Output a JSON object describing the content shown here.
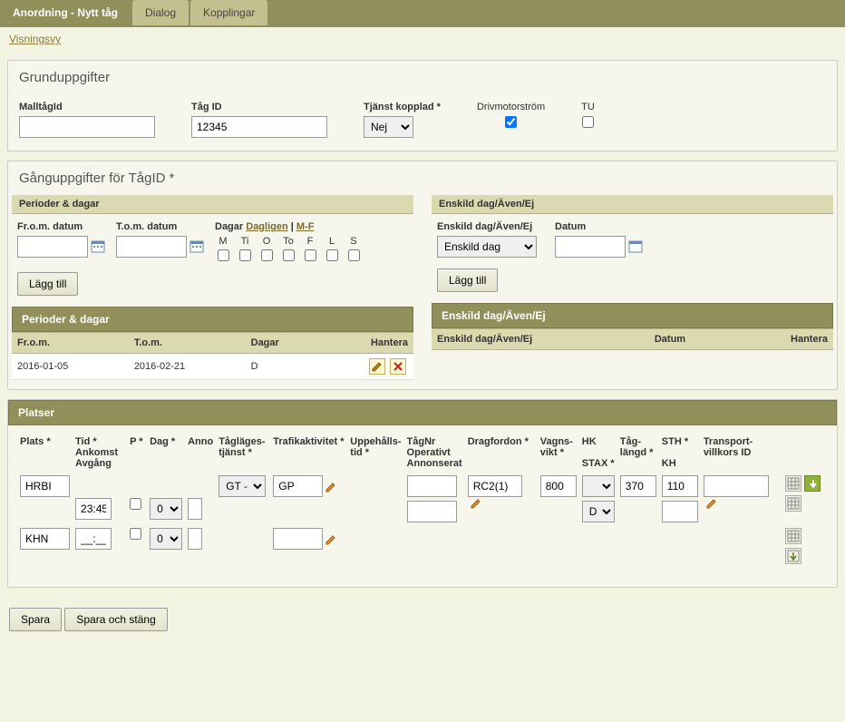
{
  "tabs": {
    "t0": "Anordning - Nytt tåg",
    "t1": "Dialog",
    "t2": "Kopplingar"
  },
  "link": {
    "visningsvy": "Visningsvy"
  },
  "grund": {
    "title": "Grunduppgifter",
    "malltagid_label": "MalltågId",
    "malltagid_value": "",
    "tagid_label": "Tåg ID",
    "tagid_value": "12345",
    "tjanst_label": "Tjänst kopplad *",
    "tjanst_value": "Nej",
    "driv_label": "Drivmotorström",
    "tu_label": "TU"
  },
  "gang": {
    "title": "Gånguppgifter för TågID  *",
    "perioder_bar": "Perioder & dagar",
    "from_label": "Fr.o.m. datum",
    "tom_label": "T.o.m. datum",
    "dagar_label": "Dagar",
    "dagligen": "Dagligen",
    "mf": "M-F",
    "sep": " | ",
    "days": {
      "m": "M",
      "ti": "Ti",
      "o": "O",
      "to": "To",
      "f": "F",
      "l": "L",
      "s": "S"
    },
    "lagg_till": "Lägg till",
    "table": {
      "h_from": "Fr.o.m.",
      "h_tom": "T.o.m.",
      "h_dagar": "Dagar",
      "h_hantera": "Hantera",
      "r0_from": "2016-01-05",
      "r0_tom": "2016-02-21",
      "r0_dagar": "D"
    },
    "enskild_bar": "Enskild dag/Även/Ej",
    "enskild_label": "Enskild dag/Även/Ej",
    "datum_label": "Datum",
    "enskild_value": "Enskild dag",
    "enskild_table": {
      "h_ens": "Enskild dag/Även/Ej",
      "h_datum": "Datum",
      "h_hantera": "Hantera"
    }
  },
  "platser": {
    "title": "Platser",
    "h_plats": "Plats *",
    "h_tid": "Tid *",
    "h_ankomst": "Ankomst",
    "h_avgang": "Avgång",
    "h_p": "P *",
    "h_dag": "Dag *",
    "h_anno": "Anno",
    "h_taglages": "Tågläges-",
    "h_tjanst": "tjänst *",
    "h_trafik": "Trafikaktivitet *",
    "h_uppeh": "Uppehålls-",
    "h_tid2": "tid *",
    "h_tagnr": "TågNr",
    "h_operativt": "Operativt",
    "h_annonserat": "Annonserat",
    "h_dragfordon": "Dragfordon *",
    "h_vagns": "Vagns-",
    "h_vikt": "vikt *",
    "h_hk": "HK",
    "h_stax": "STAX *",
    "h_taglangd": "Tåg-",
    "h_langd": "längd *",
    "h_sth": "STH *",
    "h_kh": "KH",
    "h_transport": "Transport-",
    "h_villkors": "villkors ID",
    "r0": {
      "plats": "HRBI",
      "avgang": "23:45",
      "dag": "0",
      "taglages": "GT -",
      "trafik": "GP",
      "drag": "RC2(1)",
      "vikt": "800",
      "stax": "D",
      "langd": "370",
      "sth": "110"
    },
    "r1": {
      "plats": "KHN",
      "ankomst": "__:__",
      "dag": "0"
    }
  },
  "buttons": {
    "spara": "Spara",
    "spara_stang": "Spara och stäng"
  }
}
